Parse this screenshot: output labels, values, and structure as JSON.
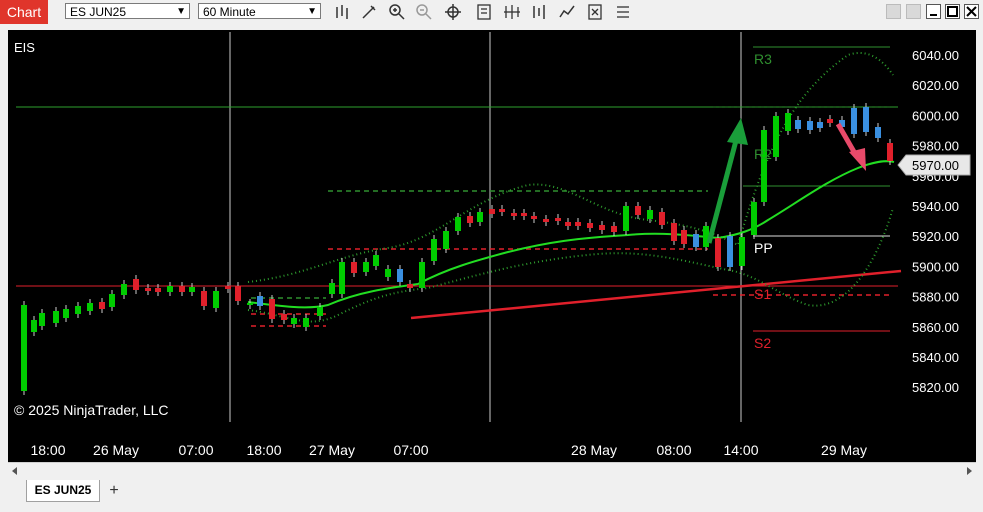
{
  "toolbar": {
    "app_label": "Chart",
    "instrument": "ES JUN25",
    "interval": "60 Minute",
    "icons": [
      "bar-type-icon",
      "draw-tool-icon",
      "zoom-in-icon",
      "zoom-out-icon",
      "crosshair-icon",
      "indicators-icon",
      "strategies-icon",
      "chart-trader-icon",
      "templates-icon",
      "properties-icon",
      "data-box-icon"
    ]
  },
  "window": {
    "minimize": "minimize",
    "maximize": "maximize",
    "close": "close"
  },
  "chart": {
    "instrument_label": "EIS",
    "copyright": "© 2025 NinjaTrader, LLC",
    "current_price": "5970.00",
    "price_ticks": [
      "6040.00",
      "6020.00",
      "6000.00",
      "5980.00",
      "5960.00",
      "5940.00",
      "5920.00",
      "5900.00",
      "5880.00",
      "5860.00",
      "5840.00",
      "5820.00"
    ],
    "time_ticks": [
      "18:00",
      "26 May",
      "07:00",
      "18:00",
      "27 May",
      "07:00",
      "28 May",
      "08:00",
      "14:00",
      "29 May"
    ],
    "pivots": {
      "r3": "R3",
      "r2": "R2",
      "pp": "PP",
      "s1": "S1",
      "s2": "S2"
    },
    "colors": {
      "bull": "#00cc00",
      "bear": "#e0202b",
      "neutral": "#3a8fe0",
      "ma": "#22dd22",
      "trend": "#e0202b"
    }
  },
  "tabs": {
    "active": "ES JUN25",
    "add": "+"
  }
}
